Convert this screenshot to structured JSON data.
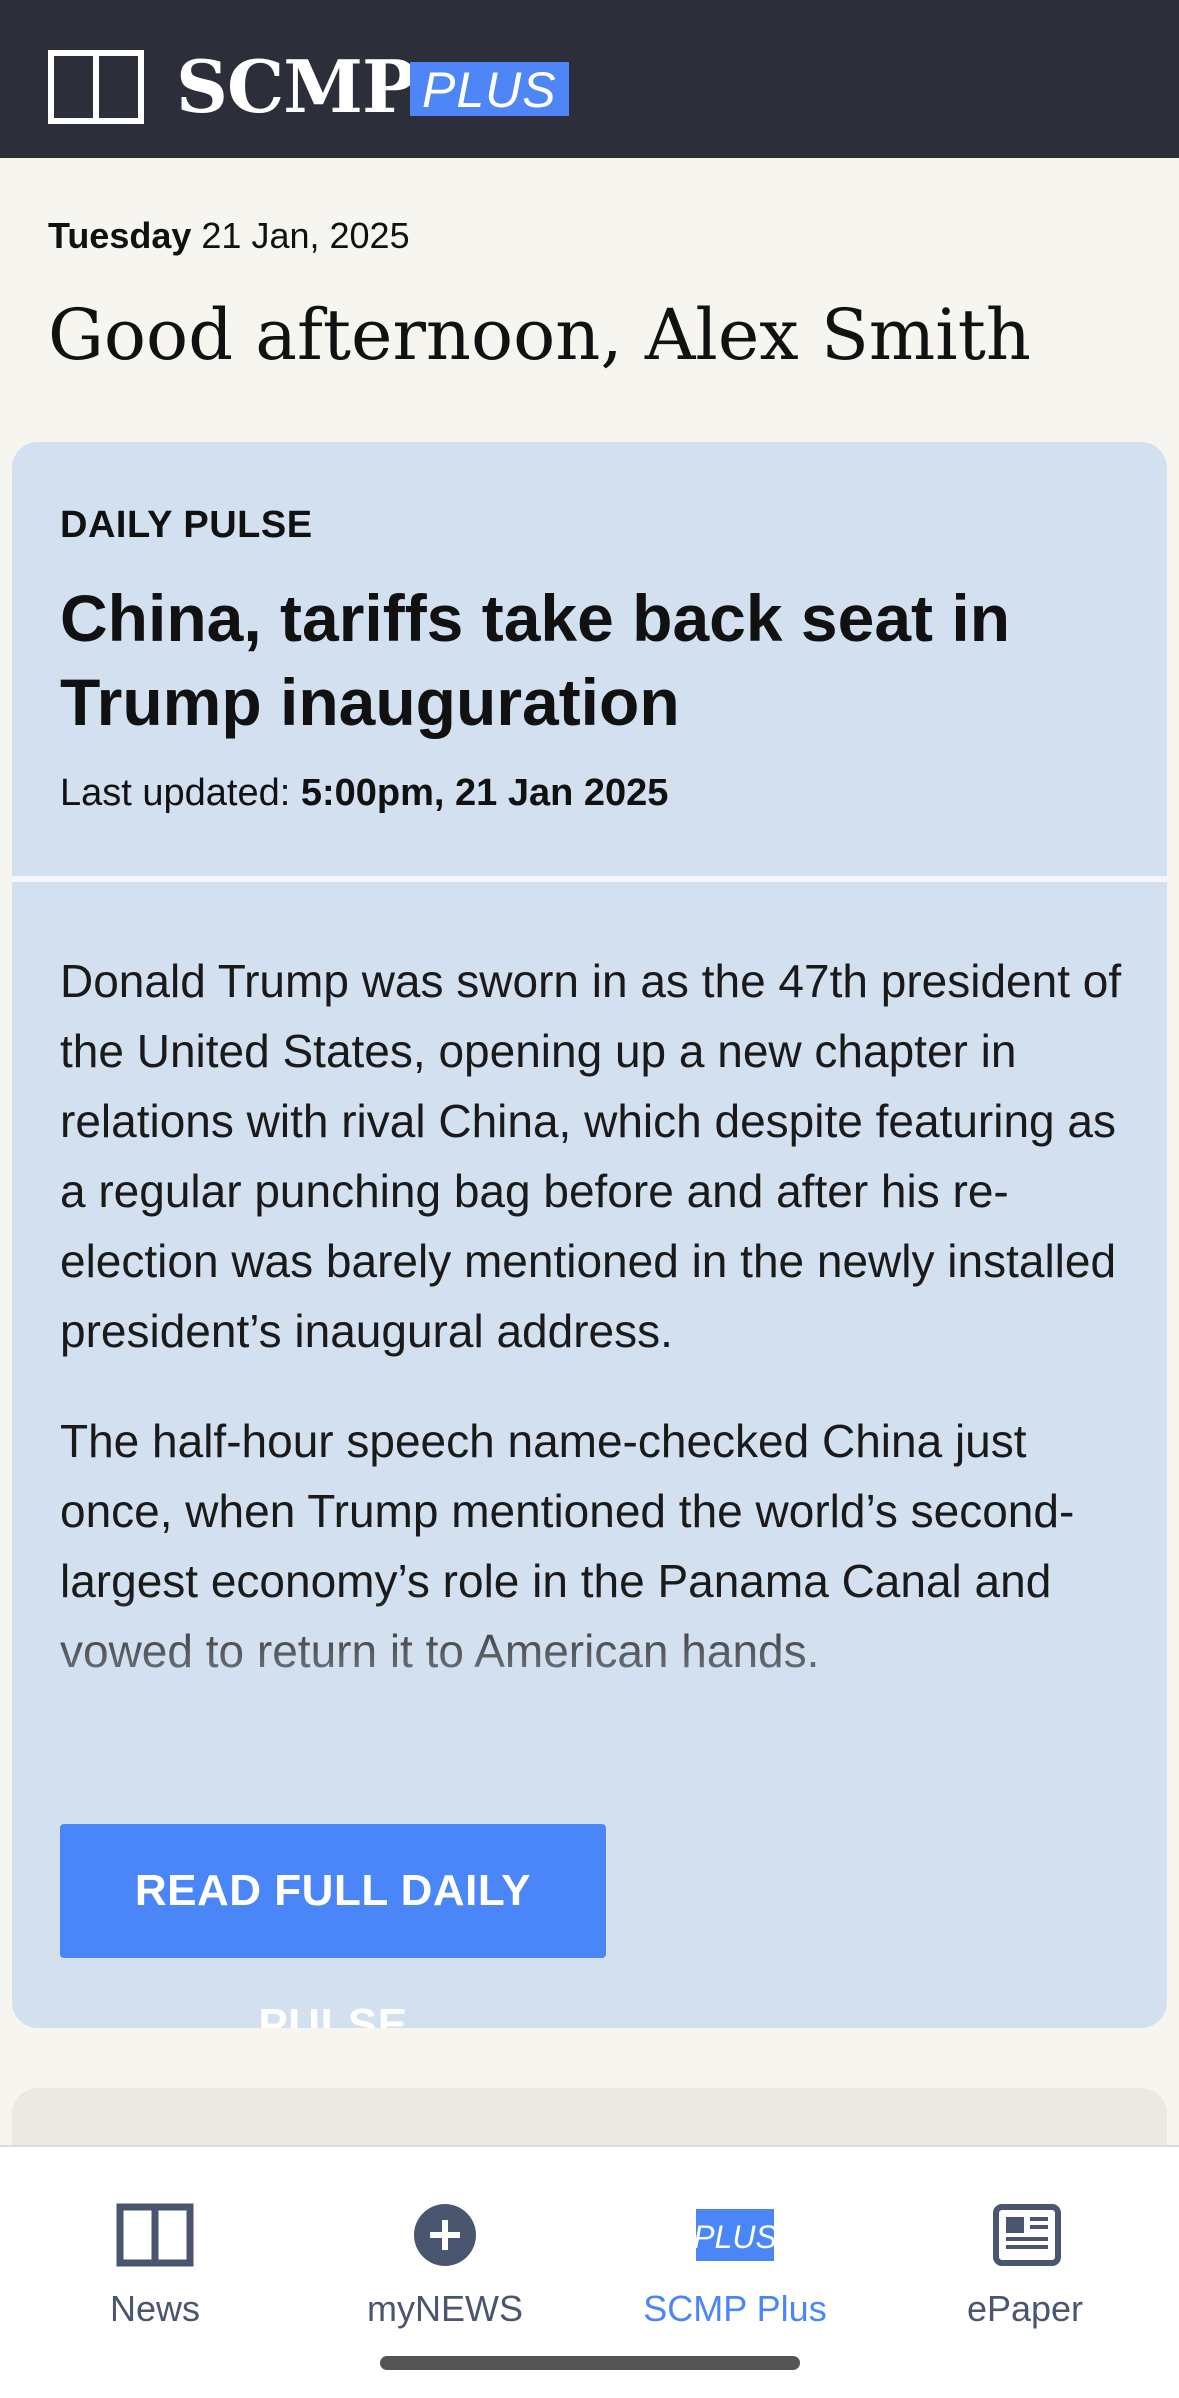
{
  "header": {
    "brand_name": "SCMP",
    "brand_plus": "PLUS",
    "colors": {
      "background": "#2c2f3a",
      "accent": "#4f86f7"
    }
  },
  "greeting": {
    "day": "Tuesday",
    "date": "21 Jan, 2025",
    "message": "Good afternoon, Alex Smith"
  },
  "daily_pulse": {
    "kicker": "DAILY PULSE",
    "headline": "China, tariffs take back seat in Trump inauguration",
    "updated_label": "Last updated:",
    "updated_value": "5:00pm, 21 Jan 2025",
    "paragraphs": [
      "Donald Trump was sworn in as the 47th president of the United States, opening up a new chapter in relations with rival China, which despite featuring as a regular punching bag before and after his re-election was barely mentioned in the newly installed president’s inaugural address.",
      "The half-hour speech name-checked China just once, when Trump mentioned the world’s second-largest economy’s role in the Panama Canal and vowed to return it to American hands."
    ],
    "button_label": "READ FULL DAILY PULSE",
    "colors": {
      "card": "#d3e0f0",
      "button": "#4a86f7"
    }
  },
  "bottom_nav": {
    "items": [
      {
        "label": "News",
        "icon": "news-book-icon"
      },
      {
        "label": "myNEWS",
        "icon": "plus-circle-icon"
      },
      {
        "label": "SCMP Plus",
        "icon": "plus-badge-icon",
        "icon_text": "PLUS",
        "active": true
      },
      {
        "label": "ePaper",
        "icon": "newspaper-icon"
      }
    ],
    "colors": {
      "active": "#4a86f7",
      "inactive": "#4a5570"
    }
  }
}
